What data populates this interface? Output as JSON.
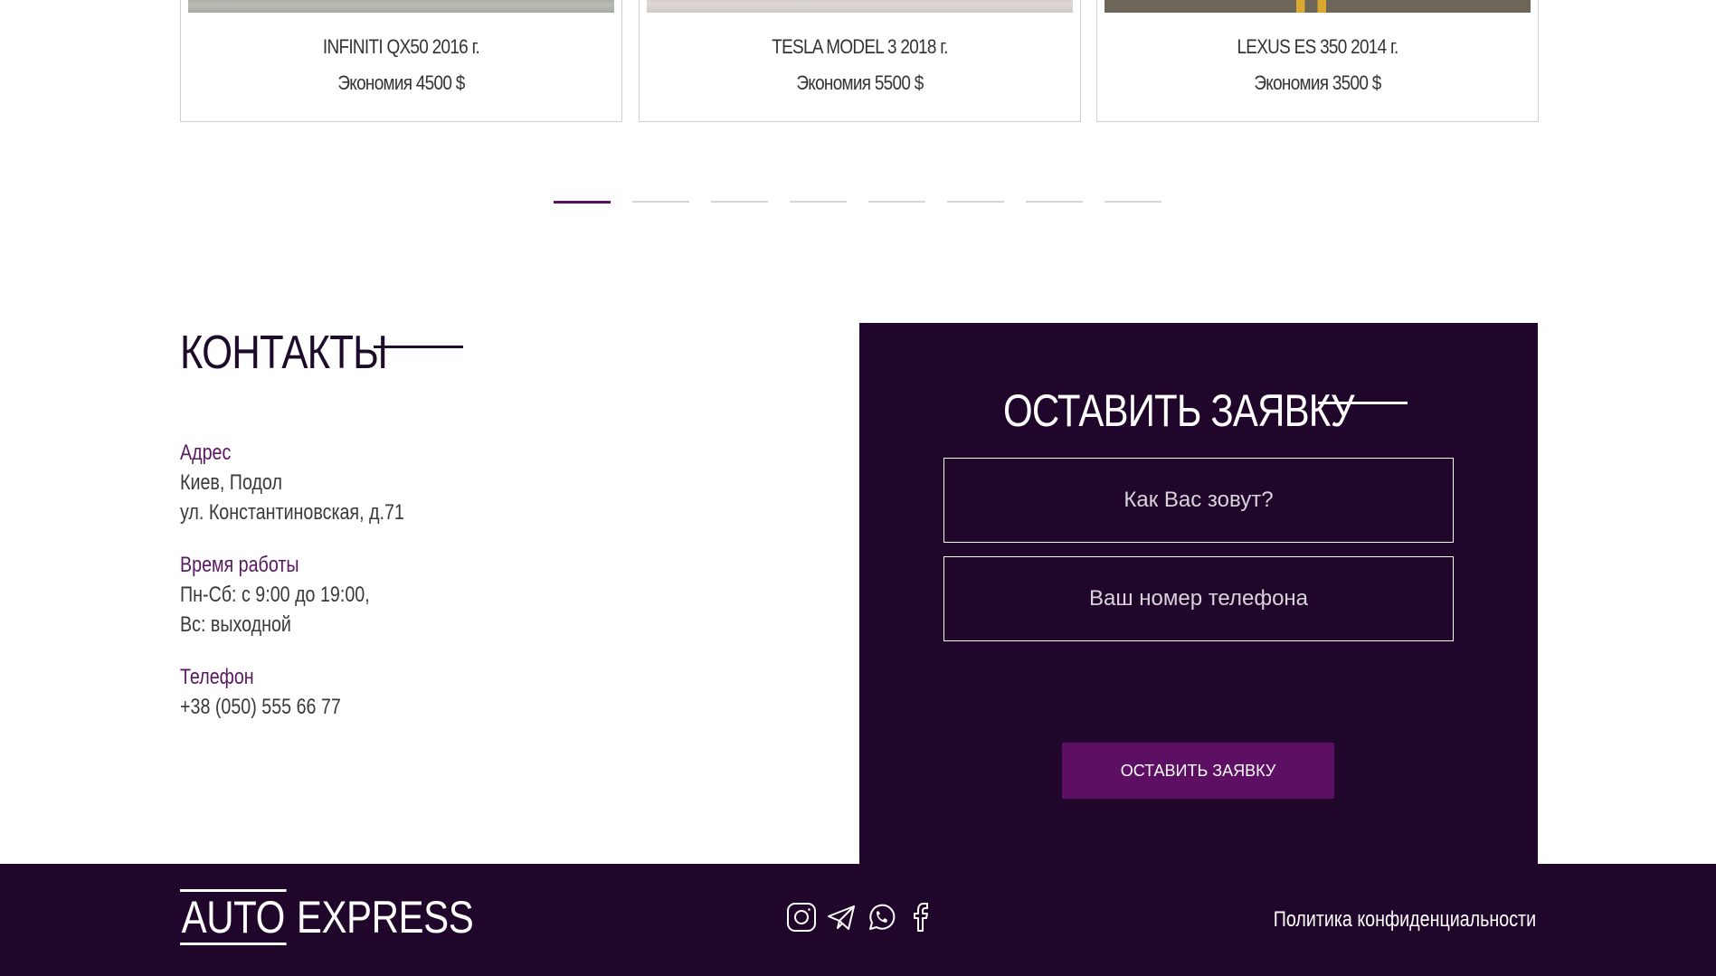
{
  "cards": [
    {
      "name": "INFINITI QX50 2016 г.",
      "saving": "Экономия 4500 $"
    },
    {
      "name": "TESLA MODEL 3 2018 г.",
      "saving": "Экономия 5500 $"
    },
    {
      "name": "LEXUS ES 350 2014 г.",
      "saving": "Экономия 3500 $"
    }
  ],
  "carousel": {
    "pages": 8,
    "active_index": 0
  },
  "contacts": {
    "title": "КОНТАКТЫ",
    "address_label": "Адрес",
    "address_line1": "Киев, Подол",
    "address_line2": "ул. Константиновская, д.71",
    "hours_label": "Время работы",
    "hours_line1": "Пн-Сб: с 9:00 до 19:00,",
    "hours_line2": "Вс: выходной",
    "phone_label": "Телефон",
    "phone": "+38 (050) 555 66 77"
  },
  "form": {
    "title": "ОСТАВИТЬ ЗАЯВКУ",
    "name_placeholder": "Как Вас зовут?",
    "phone_placeholder": "Ваш номер телефона",
    "submit_label": "ОСТАВИТЬ ЗАЯВКУ"
  },
  "footer": {
    "logo_part1": "AUTO",
    "logo_part2": "EXPRESS",
    "socials": [
      "instagram-icon",
      "telegram-icon",
      "whatsapp-icon",
      "facebook-icon"
    ],
    "policy_label": "Политика конфиденциальности"
  },
  "colors": {
    "brand_dark": "#21062b",
    "accent": "#5c0f63",
    "label": "#5a1862"
  }
}
